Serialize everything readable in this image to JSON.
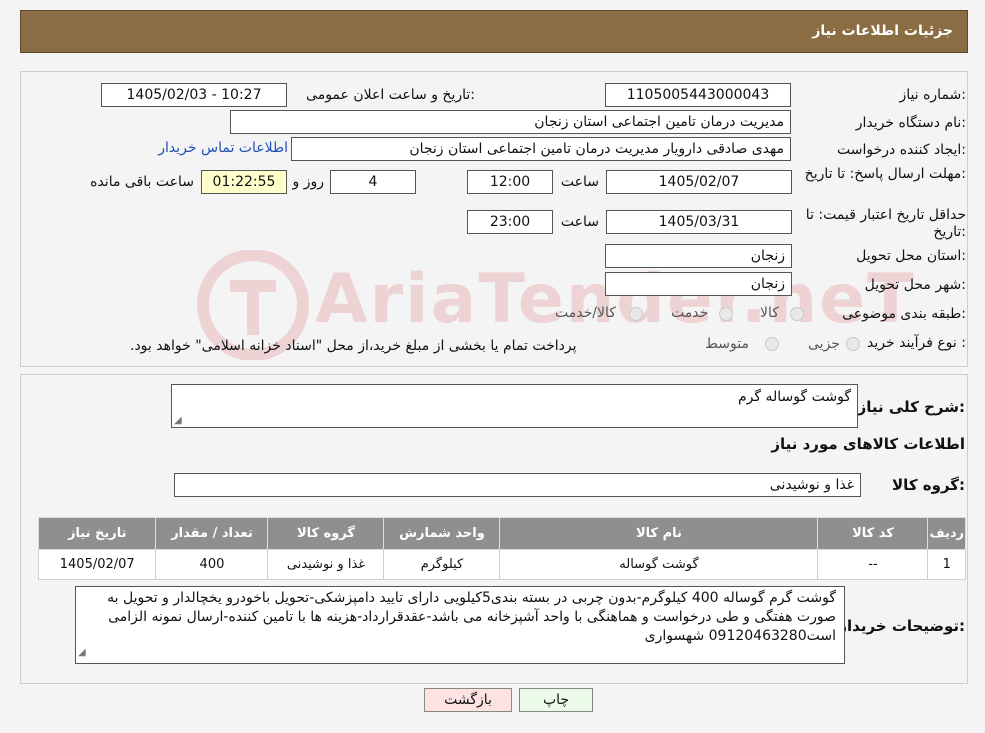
{
  "header": {
    "title": "جزئیات اطلاعات نیاز"
  },
  "form": {
    "need_number_label": "شماره نیاز:",
    "need_number": "1105005443000043",
    "announce_label": "تاریخ و ساعت اعلان عمومی:",
    "announce_value": "1405/02/03 - 10:27",
    "buyer_label": "نام دستگاه خریدار:",
    "buyer_value": "مدیریت درمان تامین اجتماعی استان زنجان",
    "creator_label": "ایجاد کننده درخواست:",
    "creator_value": "مهدی صادقی دارویار مدیریت درمان تامین اجتماعی استان زنجان",
    "contact_link": "اطلاعات تماس خریدار",
    "deadline_label": "مهلت ارسال پاسخ: تا تاریخ:",
    "deadline_date": "1405/02/07",
    "time_label": "ساعت",
    "deadline_time": "12:00",
    "days_value": "4",
    "days_label": "روز و",
    "remaining_time": "01:22:55",
    "remaining_label": "ساعت باقی مانده",
    "validity_label": "حداقل تاریخ اعتبار قیمت: تا تاریخ:",
    "validity_date": "1405/03/31",
    "validity_time": "23:00",
    "province_label": "استان محل تحویل:",
    "province_value": "زنجان",
    "city_label": "شهر محل تحویل:",
    "city_value": "زنجان",
    "category_label": "طبقه بندی موضوعی:",
    "category_options": [
      "کالا",
      "خدمت",
      "کالا/خدمت"
    ],
    "process_label": "نوع فرآیند خرید :",
    "process_options": [
      "جزیی",
      "متوسط"
    ],
    "process_note": "پرداخت تمام یا بخشی از مبلغ خرید،از محل \"اسناد خزانه اسلامی\" خواهد بود."
  },
  "details": {
    "summary_label": "شرح کلی نیاز:",
    "summary_value": "گوشت گوساله گرم",
    "items_title": "اطلاعات کالاهای مورد نیاز",
    "group_label": "گروه کالا:",
    "group_value": "غذا و نوشیدنی"
  },
  "table": {
    "headers": [
      "ردیف",
      "کد کالا",
      "نام کالا",
      "واحد شمارش",
      "گروه کالا",
      "تعداد / مقدار",
      "تاریخ نیاز"
    ],
    "rows": [
      [
        "1",
        "--",
        "گوشت گوساله",
        "کیلوگرم",
        "غذا و نوشیدنی",
        "400",
        "1405/02/07"
      ]
    ]
  },
  "notes": {
    "label": "توضیحات خریدار:",
    "value": "گوشت گرم گوساله 400 کیلوگرم-بدون چربی در بسته بندی5کیلویی دارای تایید دامپزشکی-تحویل باخودرو یخچالدار و تحویل به صورت هفتگی و طی درخواست و هماهنگی با واحد آشپزخانه می باشد-عقدقرارداد-هزینه ها با تامین کننده-ارسال نمونه الزامی است09120463280 شهسواری"
  },
  "buttons": {
    "print": "چاپ",
    "back": "بازگشت"
  },
  "watermark": {
    "text": "AriaTender.neT"
  },
  "colors": {
    "header": "#8b6d43",
    "table_header": "#8f8f8f",
    "link": "#1f4fb5",
    "timer_bg": "#ffffcc",
    "back_button": "#fde2e2",
    "print_button": "#eafbe8"
  }
}
